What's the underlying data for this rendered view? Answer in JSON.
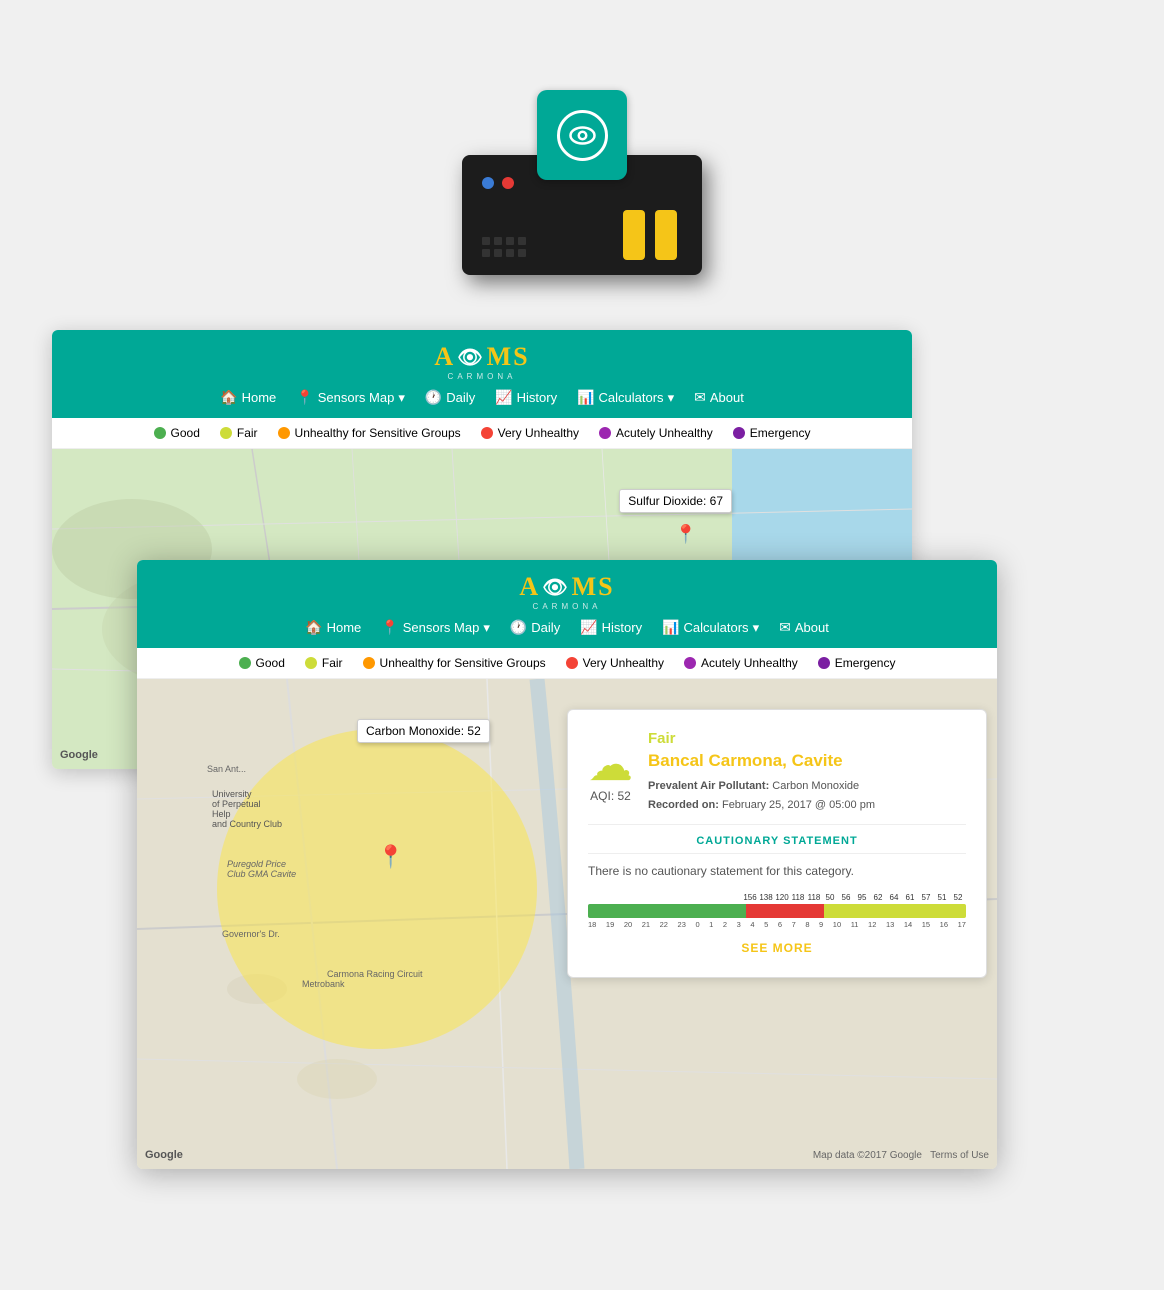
{
  "device": {
    "alt": "AQMS Hardware Device"
  },
  "back_browser": {
    "nav": {
      "logo": "AQMS",
      "subtitle": "CARMONA",
      "links": [
        {
          "label": "Home",
          "icon": "🏠"
        },
        {
          "label": "Sensors Map",
          "icon": "📍",
          "dropdown": true
        },
        {
          "label": "Daily",
          "icon": "🕐"
        },
        {
          "label": "History",
          "icon": "📈"
        },
        {
          "label": "Calculators",
          "icon": "📊",
          "dropdown": true
        },
        {
          "label": "About",
          "icon": "✉"
        }
      ]
    },
    "legend": [
      {
        "label": "Good",
        "color": "good"
      },
      {
        "label": "Fair",
        "color": "fair"
      },
      {
        "label": "Unhealthy for Sensitive Groups",
        "color": "sensitive"
      },
      {
        "label": "Very Unhealthy",
        "color": "very"
      },
      {
        "label": "Acutely Unhealthy",
        "color": "acutely"
      },
      {
        "label": "Emergency",
        "color": "emergency"
      }
    ],
    "map_popup": "Sulfur Dioxide: 67"
  },
  "front_browser": {
    "nav": {
      "logo": "AQMS",
      "subtitle": "CARMONA",
      "links": [
        {
          "label": "Home",
          "icon": "🏠"
        },
        {
          "label": "Sensors Map",
          "icon": "📍",
          "dropdown": true
        },
        {
          "label": "Daily",
          "icon": "🕐"
        },
        {
          "label": "History",
          "icon": "📈"
        },
        {
          "label": "Calculators",
          "icon": "📊",
          "dropdown": true
        },
        {
          "label": "About",
          "icon": "✉"
        }
      ]
    },
    "legend": [
      {
        "label": "Good",
        "color": "good"
      },
      {
        "label": "Fair",
        "color": "fair"
      },
      {
        "label": "Unhealthy for Sensitive Groups",
        "color": "sensitive"
      },
      {
        "label": "Very Unhealthy",
        "color": "very"
      },
      {
        "label": "Acutely Unhealthy",
        "color": "acutely"
      },
      {
        "label": "Emergency",
        "color": "emergency"
      }
    ],
    "map_popup": "Carbon Monoxide: 52",
    "info_panel": {
      "status_label": "Fair",
      "location": "Bancal Carmona, Cavite",
      "aqi_number": "AQI: 52",
      "pollutant_label": "Prevalent Air Pollutant:",
      "pollutant_value": "Carbon Monoxide",
      "recorded_label": "Recorded on:",
      "recorded_value": "February 25, 2017 @ 05:00 pm",
      "cautionary_title": "CAUTIONARY STATEMENT",
      "cautionary_text": "There is no cautionary statement for this category.",
      "see_more": "SEE MORE",
      "aqi_bar": {
        "top_values": [
          "156",
          "138",
          "120",
          "118",
          "118",
          "50",
          "56",
          "95",
          "62",
          "64",
          "61",
          "57",
          "51",
          "52"
        ],
        "bottom_labels": [
          "18",
          "19",
          "20",
          "21",
          "22",
          "23",
          "0",
          "1",
          "2",
          "3",
          "4",
          "5",
          "6",
          "7",
          "8",
          "9",
          "10",
          "11",
          "12",
          "13",
          "14",
          "15",
          "16",
          "17"
        ],
        "colors": [
          "#e53935",
          "#e53935",
          "#e53935",
          "#e53935",
          "#e53935",
          "#cddc39",
          "#cddc39",
          "#cddc39",
          "#cddc39",
          "#cddc39",
          "#cddc39",
          "#cddc39",
          "#cddc39",
          "#cddc39"
        ]
      }
    }
  }
}
